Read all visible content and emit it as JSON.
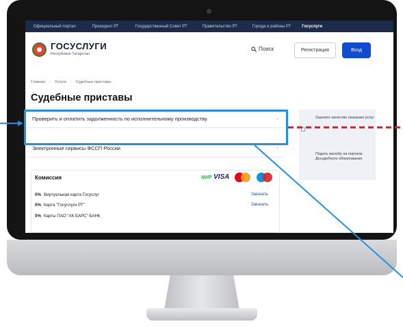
{
  "topnav": {
    "items": [
      "Официальный портал",
      "Президент РТ",
      "Государственный Совет РТ",
      "Правительство РТ",
      "Города и районы РТ",
      "Госуслуги"
    ]
  },
  "header": {
    "logo_title": "ГОСУСЛУГИ",
    "logo_subtitle": "Республики Татарстан",
    "search_label": "Поиск",
    "register_label": "Регистрация",
    "login_label": "Вход"
  },
  "breadcrumb": [
    "Главная",
    "Услуги",
    "Судебные приставы"
  ],
  "page_title": "Судебные приставы",
  "services": [
    "Проверить и оплатить задолженность по исполнительному производству",
    "Электронные сервисы ФССП России"
  ],
  "commission": {
    "title": "Комиссия",
    "payment_logos": [
      "МИР",
      "VISA",
      "mastercard",
      "maestro"
    ],
    "rows": [
      {
        "percent": "0%",
        "label": "Виртуальная карта Госуслуг",
        "link": "Заказать"
      },
      {
        "percent": "0%",
        "label": "Карта \"Госуслуги РТ\"",
        "link": "Заказать"
      },
      {
        "percent": "0%",
        "label": "Карты ПАО \"АК БАРС\" БАНК",
        "link": ""
      }
    ]
  },
  "sidebar": {
    "items": [
      "Оцените качество оказания услуг",
      "Подать жалобу на портале Досудебного обжалования"
    ]
  },
  "colors": {
    "accent": "#0d4cd3",
    "highlight": "#1e90e8",
    "dashed_line": "#c0262d",
    "topnav_bg": "#1c2b4a"
  }
}
